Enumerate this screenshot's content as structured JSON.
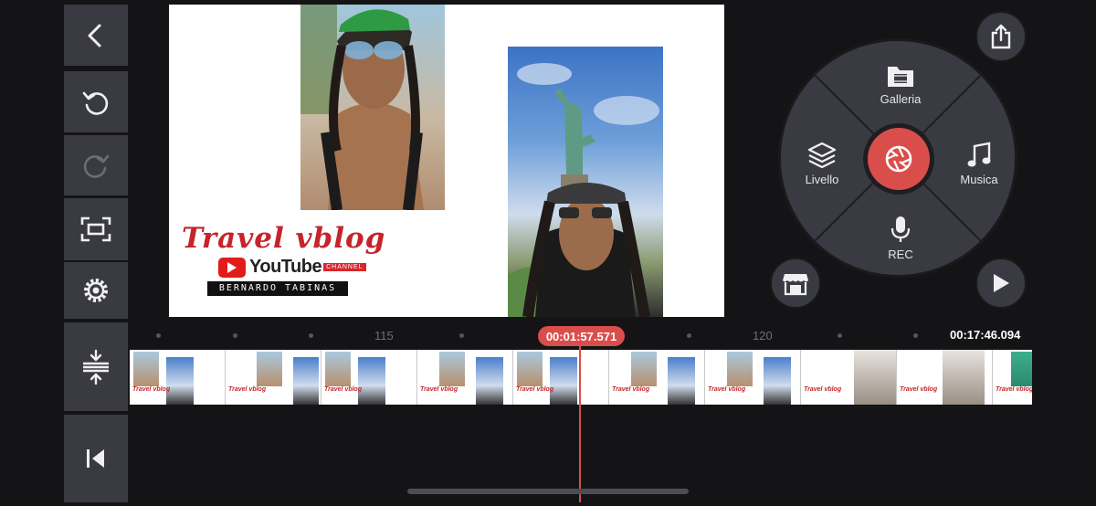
{
  "toolbar": {
    "back_icon": "chevron-left-icon",
    "undo_icon": "undo-icon",
    "redo_icon": "redo-icon",
    "fullscreen_icon": "fullscreen-icon",
    "settings_icon": "gear-icon",
    "expand_icon": "expand-tracks-icon",
    "jump_start_icon": "skip-to-start-icon"
  },
  "preview": {
    "vlog_title": "Travel vblog",
    "youtube_word": "YouTube",
    "youtube_channel": "CHANNEL",
    "channel_name": "BERNARDO TABINAS"
  },
  "wheel": {
    "galleria": "Galleria",
    "livello": "Livello",
    "musica": "Musica",
    "rec": "REC"
  },
  "timeline": {
    "ruler_115": "115",
    "ruler_120": "120",
    "current_time": "00:01:57.571",
    "total_time": "00:17:46.094",
    "frame_title": "Travel vblog"
  },
  "colors": {
    "accent": "#d94e4b",
    "panel": "#3a3b42",
    "background": "#141417"
  }
}
